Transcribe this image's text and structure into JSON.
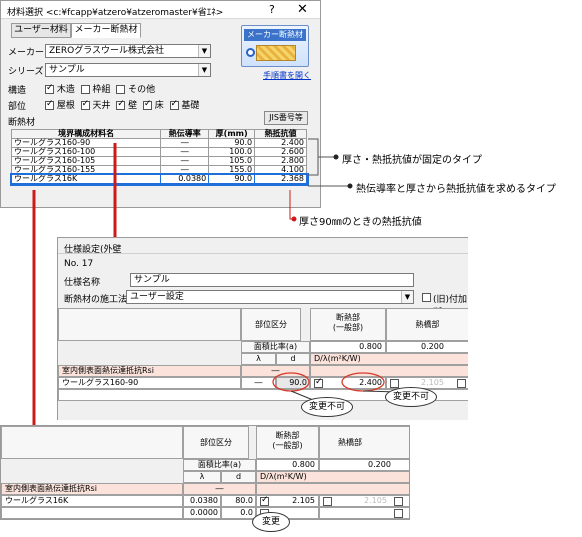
{
  "dialog": {
    "title": "材料選択 <c:¥fcapp¥atzero¥atzeromaster¥省ｴﾈ>",
    "help_icon": "?",
    "close_icon": "✕",
    "tabs": [
      "ユーザー材料",
      "メーカー断熱材"
    ],
    "maker_button_label": "メーカー断熱材",
    "manual_link": "手順書を開く",
    "maker_label": "メーカー",
    "maker_value": "ZEROグラスウール株式会社",
    "series_label": "シリーズ",
    "series_value": "サンプル",
    "structure_label": "構造",
    "structure_options": [
      {
        "label": "木造",
        "checked": true
      },
      {
        "label": "枠組",
        "checked": false
      },
      {
        "label": "その他",
        "checked": false
      }
    ],
    "part_label": "部位",
    "part_options": [
      {
        "label": "屋根",
        "checked": true
      },
      {
        "label": "天井",
        "checked": true
      },
      {
        "label": "壁",
        "checked": true
      },
      {
        "label": "床",
        "checked": true
      },
      {
        "label": "基礎",
        "checked": true
      }
    ],
    "insulation_label": "断熱材",
    "jis_button": "JIS番号等",
    "table": {
      "headers": [
        "境界構成材料名",
        "熱伝導率",
        "厚(mm)",
        "熱抵抗値"
      ],
      "rows": [
        [
          "ウールグラス160-90",
          "―",
          "90.0",
          "2.400"
        ],
        [
          "ウールグラス160-100",
          "―",
          "100.0",
          "2.600"
        ],
        [
          "ウールグラス160-105",
          "―",
          "105.0",
          "2.800"
        ],
        [
          "ウールグラス160-155",
          "―",
          "155.0",
          "4.100"
        ],
        [
          "ウールグラス16K",
          "0.0380",
          "90.0",
          "2.368"
        ]
      ]
    }
  },
  "annotations": {
    "fixed_type": "厚さ・熱抵抗値が固定のタイプ",
    "calc_type": "熱伝導率と厚さから熱抵抗値を求めるタイプ",
    "at_90mm": "厚さ90㎜のときの熱抵抗値",
    "not_changeable_1": "変更不可",
    "not_changeable_2": "変更不可",
    "change": "変更"
  },
  "mid_window": {
    "title": "仕様設定(外壁",
    "no_label": "No. 17",
    "spec_name_label": "仕様名称",
    "spec_name_value": "サンプル",
    "method_label": "断熱材の施工法",
    "method_value": "ユーザー設定",
    "option_label": "(旧)付加断",
    "part_header": "部位区分",
    "col_insul": "断熱部\n(一般部)",
    "col_heat": "熱橋部",
    "area_label": "面積比率(a)",
    "area_insul": "0.800",
    "area_heat": "0.200",
    "lambda_header": "λ",
    "d_header": "d",
    "d_lambda": "D/λ(m²K/W)",
    "rsi_label": "室内側表面熱伝達抵抗Rsi",
    "rsi_value": "―",
    "row_name": "ウールグラス160-90",
    "row_lambda": "―",
    "row_d": "90.0",
    "row_val": "2.400",
    "row_gray": "2.105"
  },
  "bot_window": {
    "part_header": "部位区分",
    "col_insul": "断熱部\n(一般部)",
    "col_heat": "熱橋部",
    "area_label": "面積比率(a)",
    "area_insul": "0.800",
    "area_heat": "0.200",
    "lambda_header": "λ",
    "d_header": "d",
    "d_lambda": "D/λ(m²K/W)",
    "rsi_label": "室内側表面熱伝達抵抗Rsi",
    "rsi_value": "―",
    "row1_name": "ウールグラス16K",
    "row1_lambda": "0.0380",
    "row1_d": "80.0",
    "row1_val": "2.105",
    "row1_gray": "2.105",
    "row2_lambda": "0.0000",
    "row2_d": "0.0"
  },
  "colors": {
    "arrow": "#cc1a1a",
    "bracket": "#555555",
    "selection": "#1e6fd9",
    "highlight_circle": "#d63a2a"
  }
}
